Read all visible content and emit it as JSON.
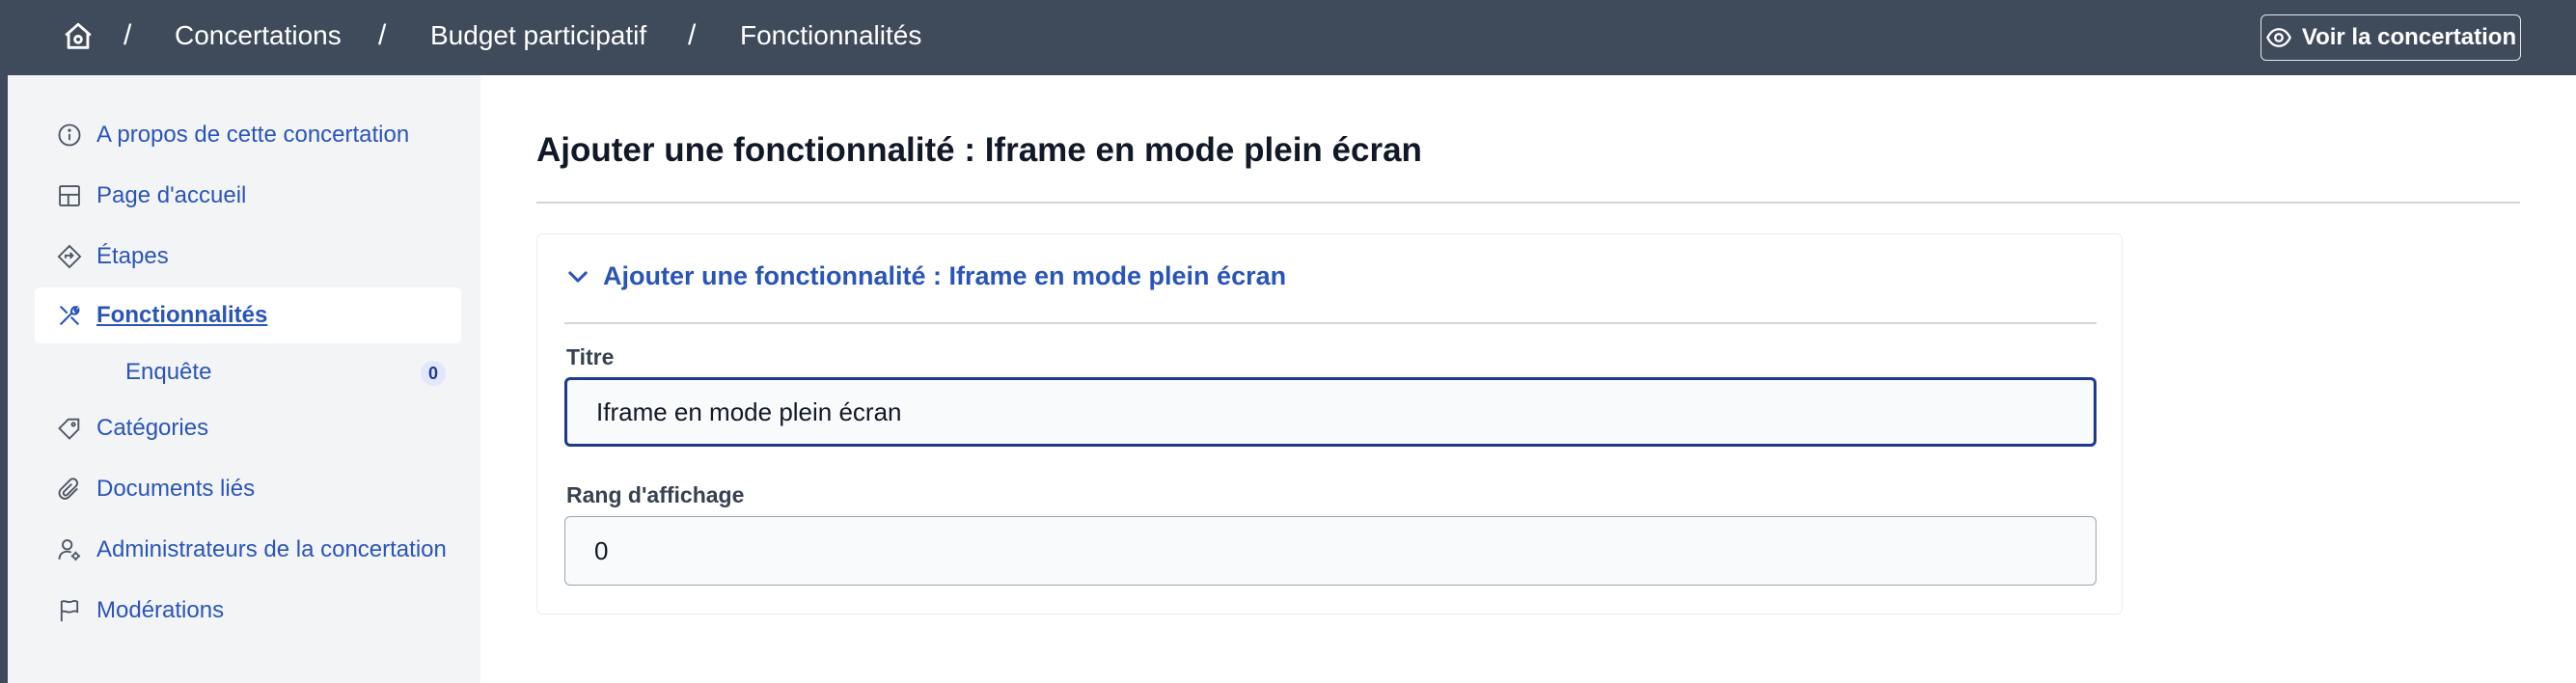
{
  "breadcrumb": {
    "home_icon": "home-icon",
    "items": [
      "Concertations",
      "Budget participatif",
      "Fonctionnalités"
    ],
    "separator": "/"
  },
  "header": {
    "view_button_label": "Voir la concertation",
    "view_button_icon": "eye-icon"
  },
  "sidebar": {
    "items": [
      {
        "label": "A propos de cette concertation",
        "icon": "info-icon"
      },
      {
        "label": "Page d'accueil",
        "icon": "layout-icon"
      },
      {
        "label": "Étapes",
        "icon": "steps-icon"
      },
      {
        "label": "Fonctionnalités",
        "icon": "tools-icon",
        "active": true
      },
      {
        "label": "Catégories",
        "icon": "tag-icon"
      },
      {
        "label": "Documents liés",
        "icon": "paperclip-icon"
      },
      {
        "label": "Administrateurs de la concertation",
        "icon": "user-gear-icon"
      },
      {
        "label": "Modérations",
        "icon": "flag-icon"
      }
    ],
    "sub_items": [
      {
        "label": "Enquête",
        "count": "0"
      }
    ]
  },
  "main": {
    "title": "Ajouter une fonctionnalité : Iframe en mode plein écran",
    "card": {
      "header_label": "Ajouter une fonctionnalité : Iframe en mode plein écran",
      "fields": {
        "titre": {
          "label": "Titre",
          "value": "Iframe en mode plein écran"
        },
        "rang": {
          "label": "Rang d'affichage",
          "value": "0"
        }
      }
    }
  },
  "colors": {
    "topbar": "#3f4b5b",
    "link": "#2a55b8",
    "sidebar_bg": "#f3f4f6",
    "focus_border": "#1e3a8a"
  }
}
